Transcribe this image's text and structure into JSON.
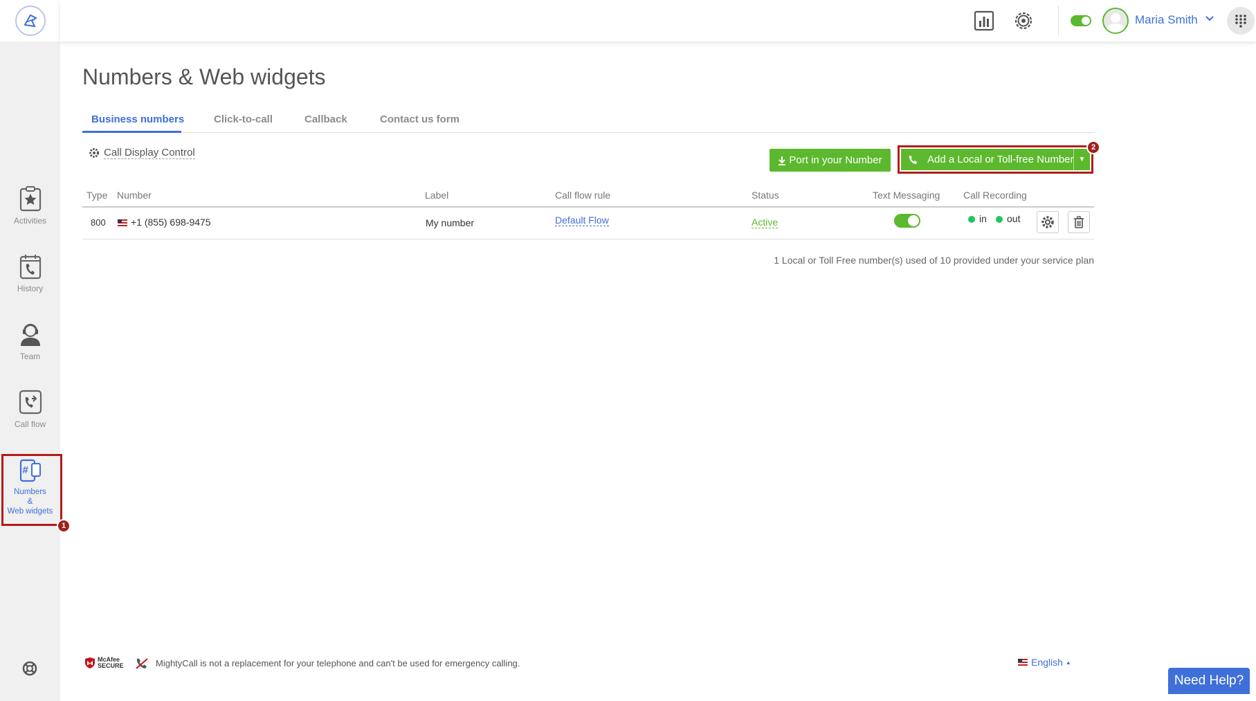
{
  "sidebar": {
    "items": [
      {
        "label": "Activities",
        "icon": "clipboard-star-icon"
      },
      {
        "label": "History",
        "icon": "calendar-phone-icon"
      },
      {
        "label": "Team",
        "icon": "headset-user-icon"
      },
      {
        "label": "Call flow",
        "icon": "call-flow-icon"
      },
      {
        "label": "Numbers\n&\nWeb widgets",
        "icon": "numbers-widget-icon"
      }
    ],
    "badge_1": "1"
  },
  "header": {
    "user_name": "Maria Smith"
  },
  "page": {
    "title": "Numbers & Web widgets",
    "tabs": [
      "Business numbers",
      "Click-to-call",
      "Callback",
      "Contact us form"
    ],
    "call_display_control": "Call Display Control",
    "port_button": "Port in your Number",
    "add_button": "Add a Local or Toll-free Number",
    "badge_2": "2"
  },
  "table": {
    "headers": [
      "Type",
      "Number",
      "Label",
      "Call flow rule",
      "Status",
      "Text Messaging",
      "Call Recording"
    ],
    "rows": [
      {
        "type": "800",
        "number": "+1 (855) 698-9475",
        "label": "My number",
        "call_flow_rule": "Default Flow",
        "status": "Active",
        "recording_in": "in",
        "recording_out": "out"
      }
    ],
    "usage": "1 Local or Toll Free number(s) used of 10 provided under your service plan"
  },
  "footer": {
    "mcafee_line1": "McAfee",
    "mcafee_line2": "SECURE",
    "disclaimer": "MightyCall is not a replacement for your telephone and can't be used for emergency calling.",
    "language": "English",
    "need_help": "Need Help?"
  },
  "colors": {
    "accent": "#3f6fd8",
    "green": "#5cb82d",
    "highlight": "#b31b1b"
  }
}
